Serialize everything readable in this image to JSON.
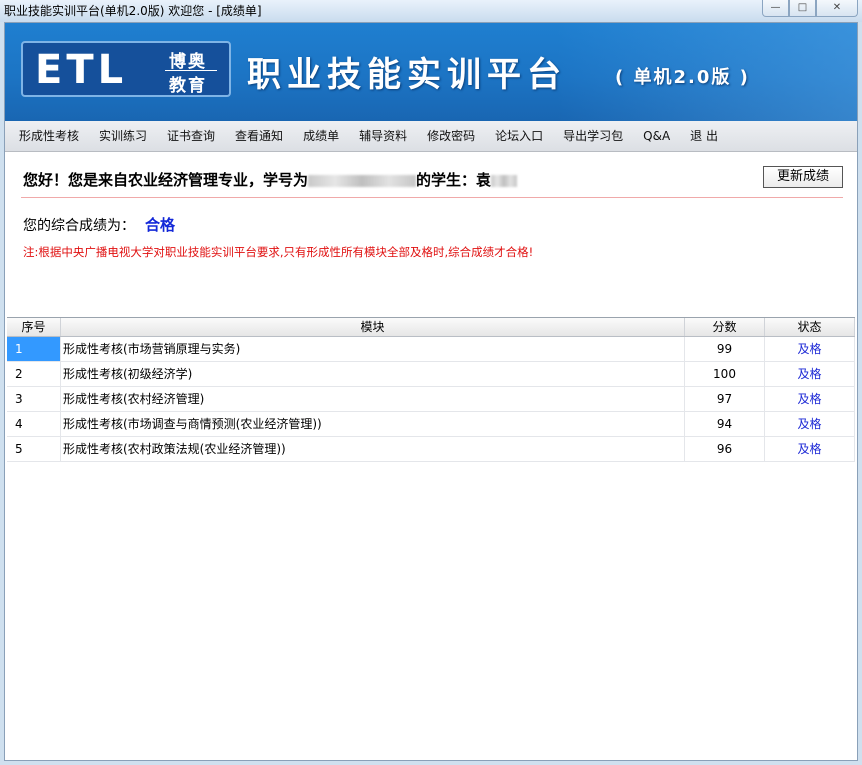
{
  "window": {
    "title": "职业技能实训平台(单机2.0版)  欢迎您 - [成绩单]",
    "controls": {
      "minimize": "—",
      "maximize": "□",
      "close": "✕"
    }
  },
  "banner": {
    "logo_text": "ETL",
    "logo_cn_top": "博奥",
    "logo_cn_bottom": "教育",
    "app_title": "职业技能实训平台",
    "edition": "( 单机2.0版 )"
  },
  "menu": [
    "形成性考核",
    "实训练习",
    "证书查询",
    "查看通知",
    "成绩单",
    "辅导资料",
    "修改密码",
    "论坛入口",
    "导出学习包",
    "Q&A",
    "退 出"
  ],
  "greeting": {
    "part1": "您好！您是来自农业经济管理专业，学号为",
    "part2": "的学生：袁"
  },
  "update_button": "更新成绩",
  "score": {
    "label": "您的综合成绩为：",
    "value": "合格"
  },
  "note": "注:根据中央广播电视大学对职业技能实训平台要求,只有形成性所有模块全部及格时,综合成绩才合格!",
  "table": {
    "headers": [
      "序号",
      "模块",
      "分数",
      "状态"
    ],
    "rows": [
      {
        "no": "1",
        "module": "形成性考核(市场营销原理与实务)",
        "score": "99",
        "status": "及格"
      },
      {
        "no": "2",
        "module": "形成性考核(初级经济学)",
        "score": "100",
        "status": "及格"
      },
      {
        "no": "3",
        "module": "形成性考核(农村经济管理)",
        "score": "97",
        "status": "及格"
      },
      {
        "no": "4",
        "module": "形成性考核(市场调查与商情预测(农业经济管理))",
        "score": "94",
        "status": "及格"
      },
      {
        "no": "5",
        "module": "形成性考核(农村政策法规(农业经济管理))",
        "score": "96",
        "status": "及格"
      }
    ]
  }
}
